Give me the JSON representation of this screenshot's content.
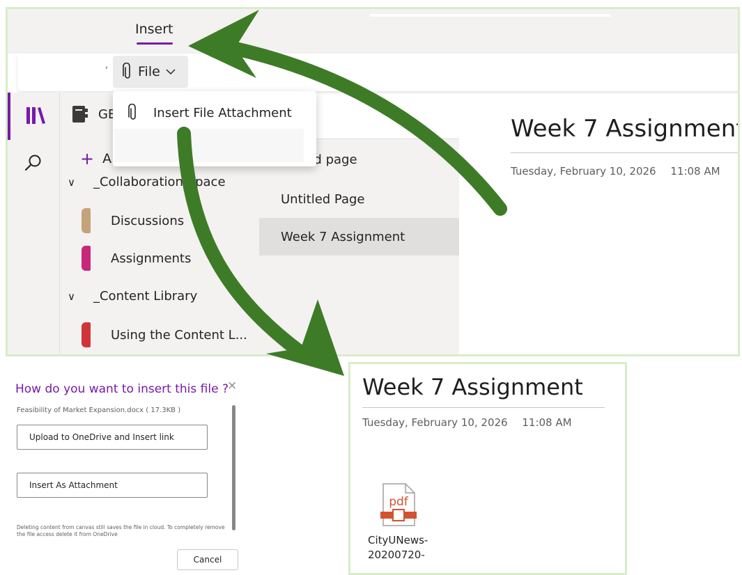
{
  "ribbon": {
    "active_tab": "Insert"
  },
  "toolbar": {
    "file_label": "File"
  },
  "dropdown": {
    "insert_file_attachment": "Insert File Attachment"
  },
  "sidebar": {
    "notebook_name": "GE",
    "add_section_label": "A",
    "section_groups": [
      {
        "name": "_Collaboration Space",
        "sections": [
          {
            "name": "Discussions",
            "color": "#c4a27a"
          },
          {
            "name": "Assignments",
            "color": "#c7287a"
          }
        ]
      },
      {
        "name": "_Content Library",
        "sections": [
          {
            "name": "Using the Content L...",
            "color": "#d13438"
          }
        ]
      }
    ]
  },
  "pages": {
    "add_page_label": "dd page",
    "items": [
      "Untitled Page",
      "Week 7 Assignment"
    ],
    "selected_index": 1
  },
  "page": {
    "title": "Week 7 Assignment",
    "date": "Tuesday, February 10, 2026",
    "time": "11:08 AM"
  },
  "dialog": {
    "title": "How do you want to insert this file ?",
    "close": "×",
    "file_info": "Feasibility of Market Expansion.docx ( 17.3KB )",
    "option_upload": "Upload to OneDrive and Insert link",
    "option_attachment": "Insert As Attachment",
    "note": "Deleting content from canvas still saves the file in cloud. To completely remove the file access delete it from OneDrive",
    "cancel": "Cancel"
  },
  "attachment": {
    "type_label": "pdf",
    "name_line1": "CityUNews-",
    "name_line2": "20200720-"
  },
  "colors": {
    "accent": "#7719aa",
    "arrow": "#3e7b27",
    "panel_border": "#d7edc8",
    "pdf": "#d35230"
  }
}
